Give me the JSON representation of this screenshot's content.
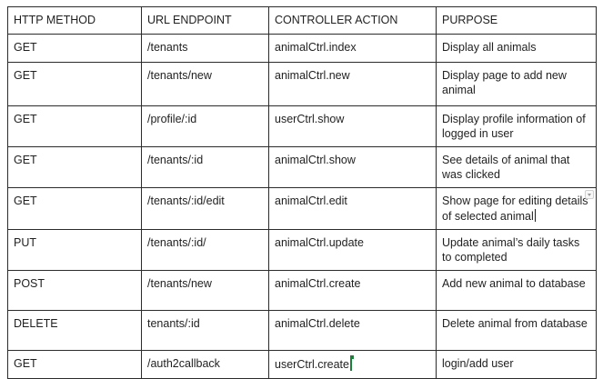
{
  "table": {
    "headers": [
      "HTTP METHOD",
      "URL ENDPOINT",
      "CONTROLLER ACTION",
      "PURPOSE"
    ],
    "rows": [
      {
        "method": "GET",
        "endpoint": "/tenants",
        "action": "animalCtrl.index",
        "purpose": "Display all animals"
      },
      {
        "method": "GET",
        "endpoint": "/tenants/new",
        "action": "animalCtrl.new",
        "purpose": "Display page to add new animal"
      },
      {
        "method": "GET",
        "endpoint": "/profile/:id",
        "action": "userCtrl.show",
        "purpose": "Display profile information of logged in user"
      },
      {
        "method": "GET",
        "endpoint": "/tenants/:id",
        "action": "animalCtrl.show",
        "purpose": "See details of animal that was clicked"
      },
      {
        "method": "GET",
        "endpoint": "/tenants/:id/edit",
        "action": "animalCtrl.edit",
        "purpose": "Show page for editing details of selected animal"
      },
      {
        "method": "PUT",
        "endpoint": "/tenants/:id/",
        "action": "animalCtrl.update",
        "purpose": "Update animal’s daily tasks to completed"
      },
      {
        "method": "POST",
        "endpoint": "/tenants/new",
        "action": "animalCtrl.create",
        "purpose": "Add new animal to database"
      },
      {
        "method": "DELETE",
        "endpoint": "tenants/:id",
        "action": "animalCtrl.delete",
        "purpose": "Delete animal from database"
      },
      {
        "method": "GET",
        "endpoint": "/auth2callback",
        "action": "userCtrl.create",
        "purpose": "login/add user"
      }
    ]
  },
  "colors": {
    "border": "#2b2b2b",
    "text": "#1f1f1f",
    "collaborator_cursor": "#188038"
  },
  "icons": {
    "cell_menu": "chevron-down-icon",
    "collaborator_cursor": "collaborator-cursor-icon",
    "text_cursor": "text-cursor-icon"
  }
}
